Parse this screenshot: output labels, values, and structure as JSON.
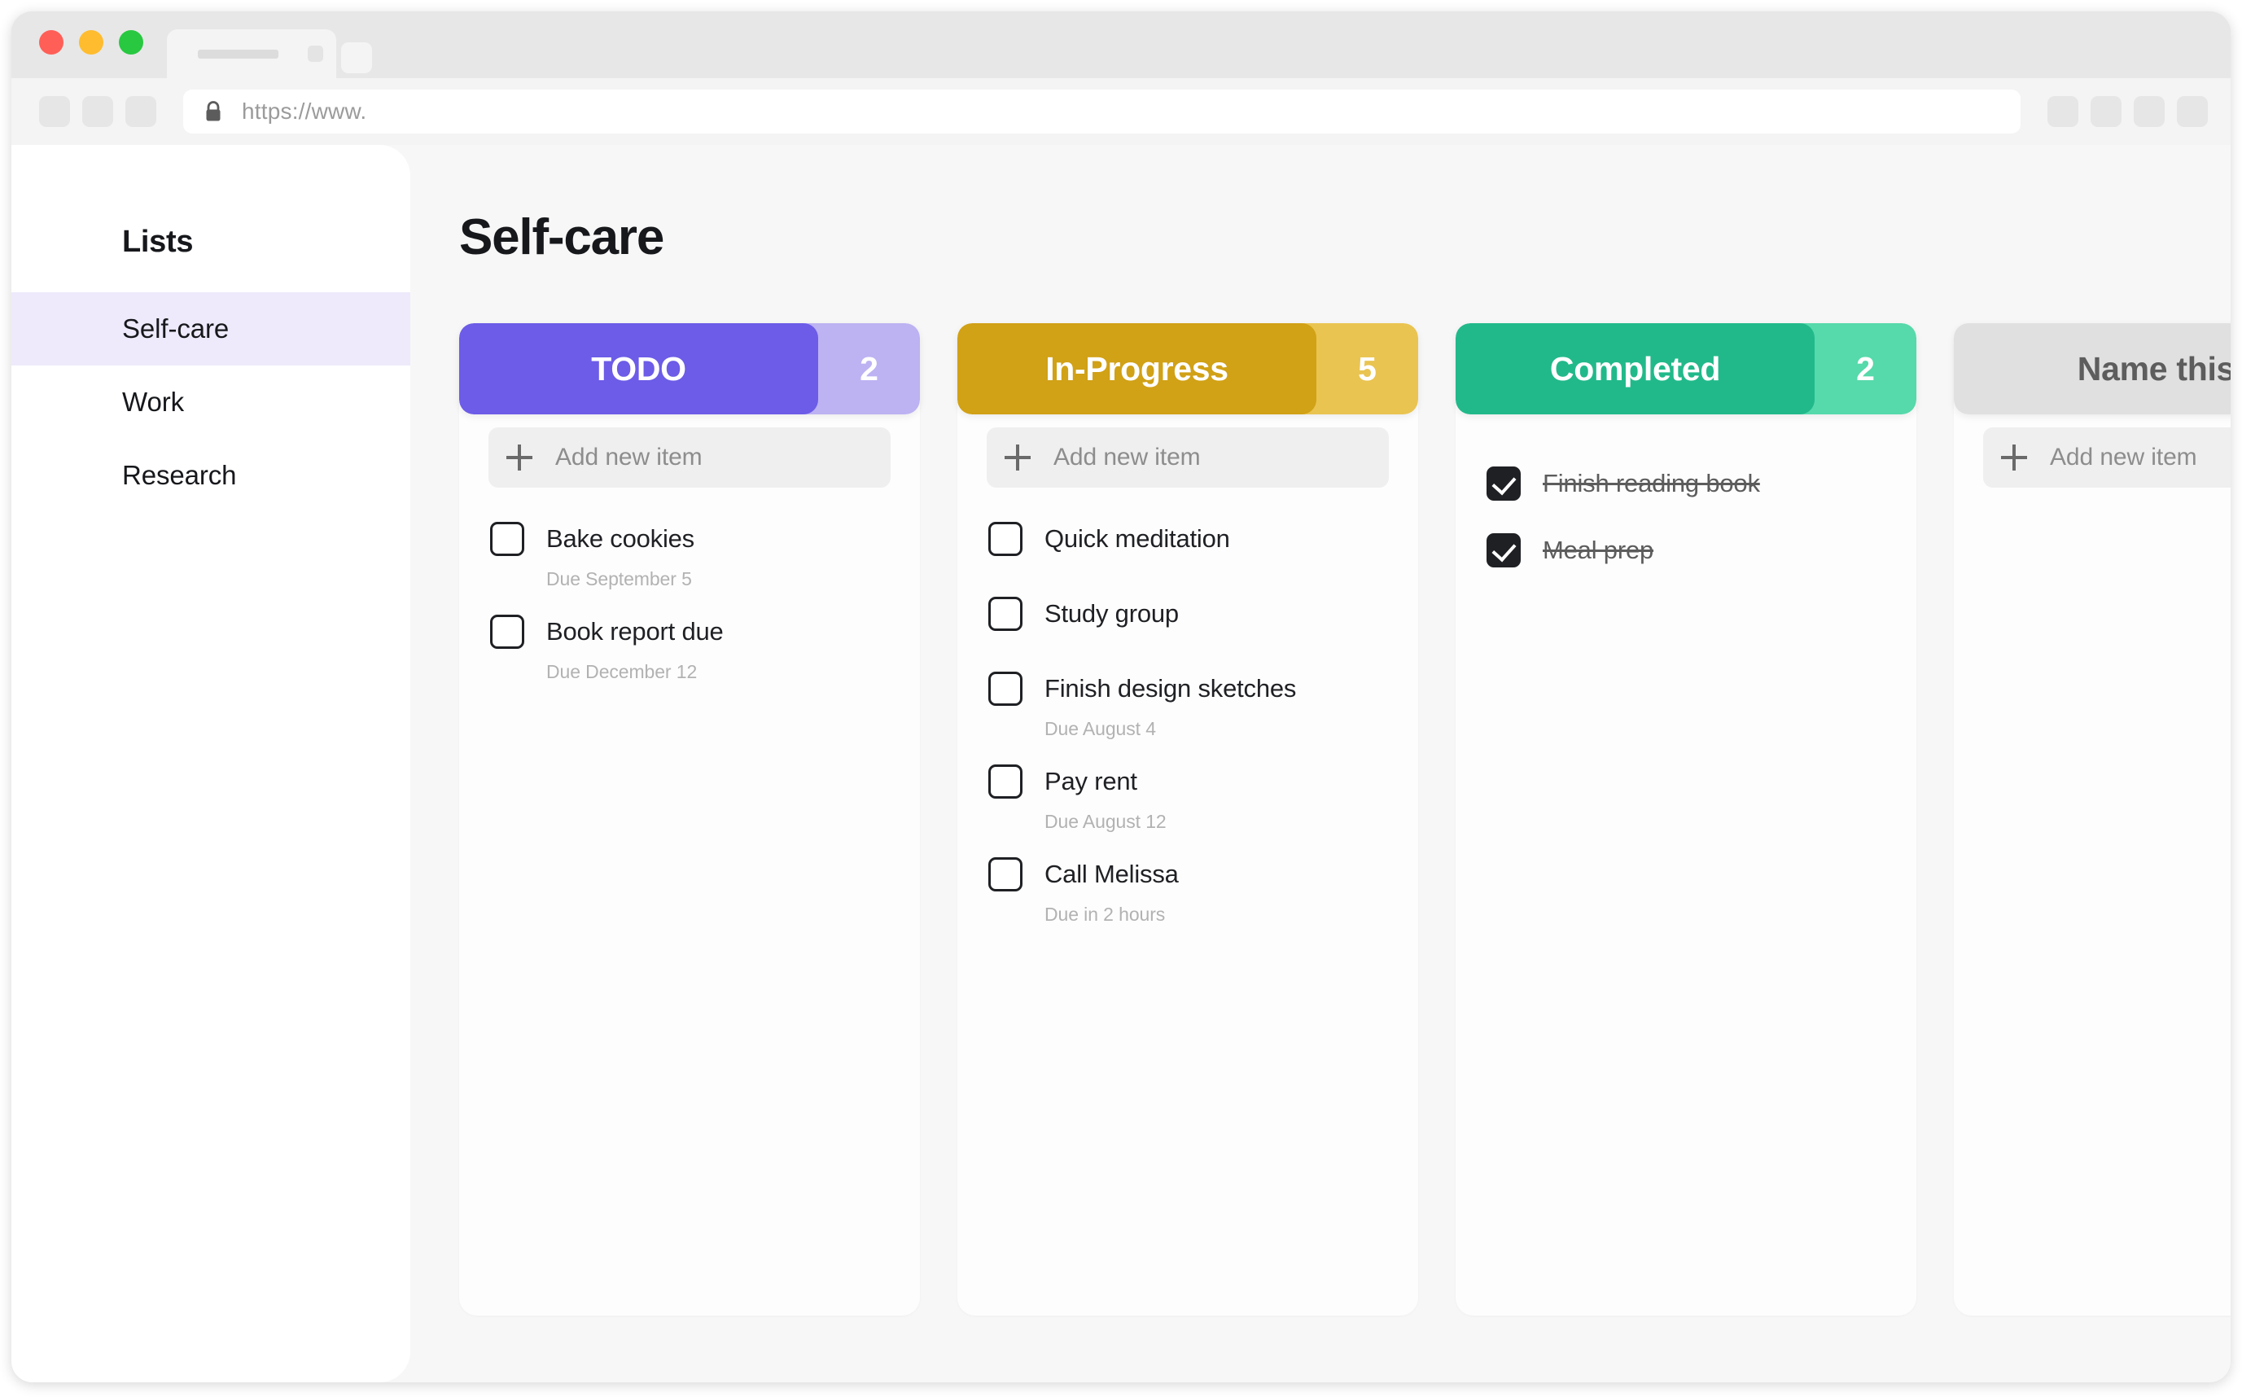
{
  "browser": {
    "traffic_lights": [
      "close",
      "minimize",
      "maximize"
    ],
    "url_text": "https://www.",
    "lock_icon": "lock-icon",
    "nav_buttons": [
      "back",
      "forward",
      "reload"
    ],
    "toolbar_right_buttons": [
      "ext-1",
      "ext-2",
      "ext-3",
      "ext-4"
    ]
  },
  "sidebar": {
    "title": "Lists",
    "items": [
      {
        "label": "Self-care",
        "active": true
      },
      {
        "label": "Work",
        "active": false
      },
      {
        "label": "Research",
        "active": false
      }
    ]
  },
  "board": {
    "title": "Self-care",
    "add_item_label": "Add new item",
    "columns": [
      {
        "name": "TODO",
        "count": "2",
        "color": "#6c5ce7",
        "badge_color": "#bdb2f2",
        "text_color": "#ffffff",
        "has_add_row": true,
        "tasks": [
          {
            "label": "Bake cookies",
            "due": "Due September 5",
            "checked": false
          },
          {
            "label": "Book report due",
            "due": "Due December 12",
            "checked": false
          }
        ]
      },
      {
        "name": "In-Progress",
        "count": "5",
        "color": "#d1a116",
        "badge_color": "#e9c451",
        "text_color": "#ffffff",
        "has_add_row": true,
        "tasks": [
          {
            "label": "Quick meditation",
            "due": "",
            "checked": false
          },
          {
            "label": "Study group",
            "due": "",
            "checked": false
          },
          {
            "label": "Finish design sketches",
            "due": "Due August 4",
            "checked": false
          },
          {
            "label": "Pay rent",
            "due": "Due August 12",
            "checked": false
          },
          {
            "label": "Call Melissa",
            "due": "Due in 2 hours",
            "checked": false
          }
        ]
      },
      {
        "name": "Completed",
        "count": "2",
        "color": "#22b98a",
        "badge_color": "#56d9ab",
        "text_color": "#ffffff",
        "has_add_row": false,
        "tasks": [
          {
            "label": "Finish reading book",
            "due": "",
            "checked": true
          },
          {
            "label": "Meal prep",
            "due": "",
            "checked": true
          }
        ]
      },
      {
        "name": "Name this list",
        "count": "",
        "color": "#e0e0e0",
        "badge_color": "#e0e0e0",
        "text_color": "#5d5d5d",
        "has_add_row": true,
        "tasks": []
      }
    ]
  }
}
